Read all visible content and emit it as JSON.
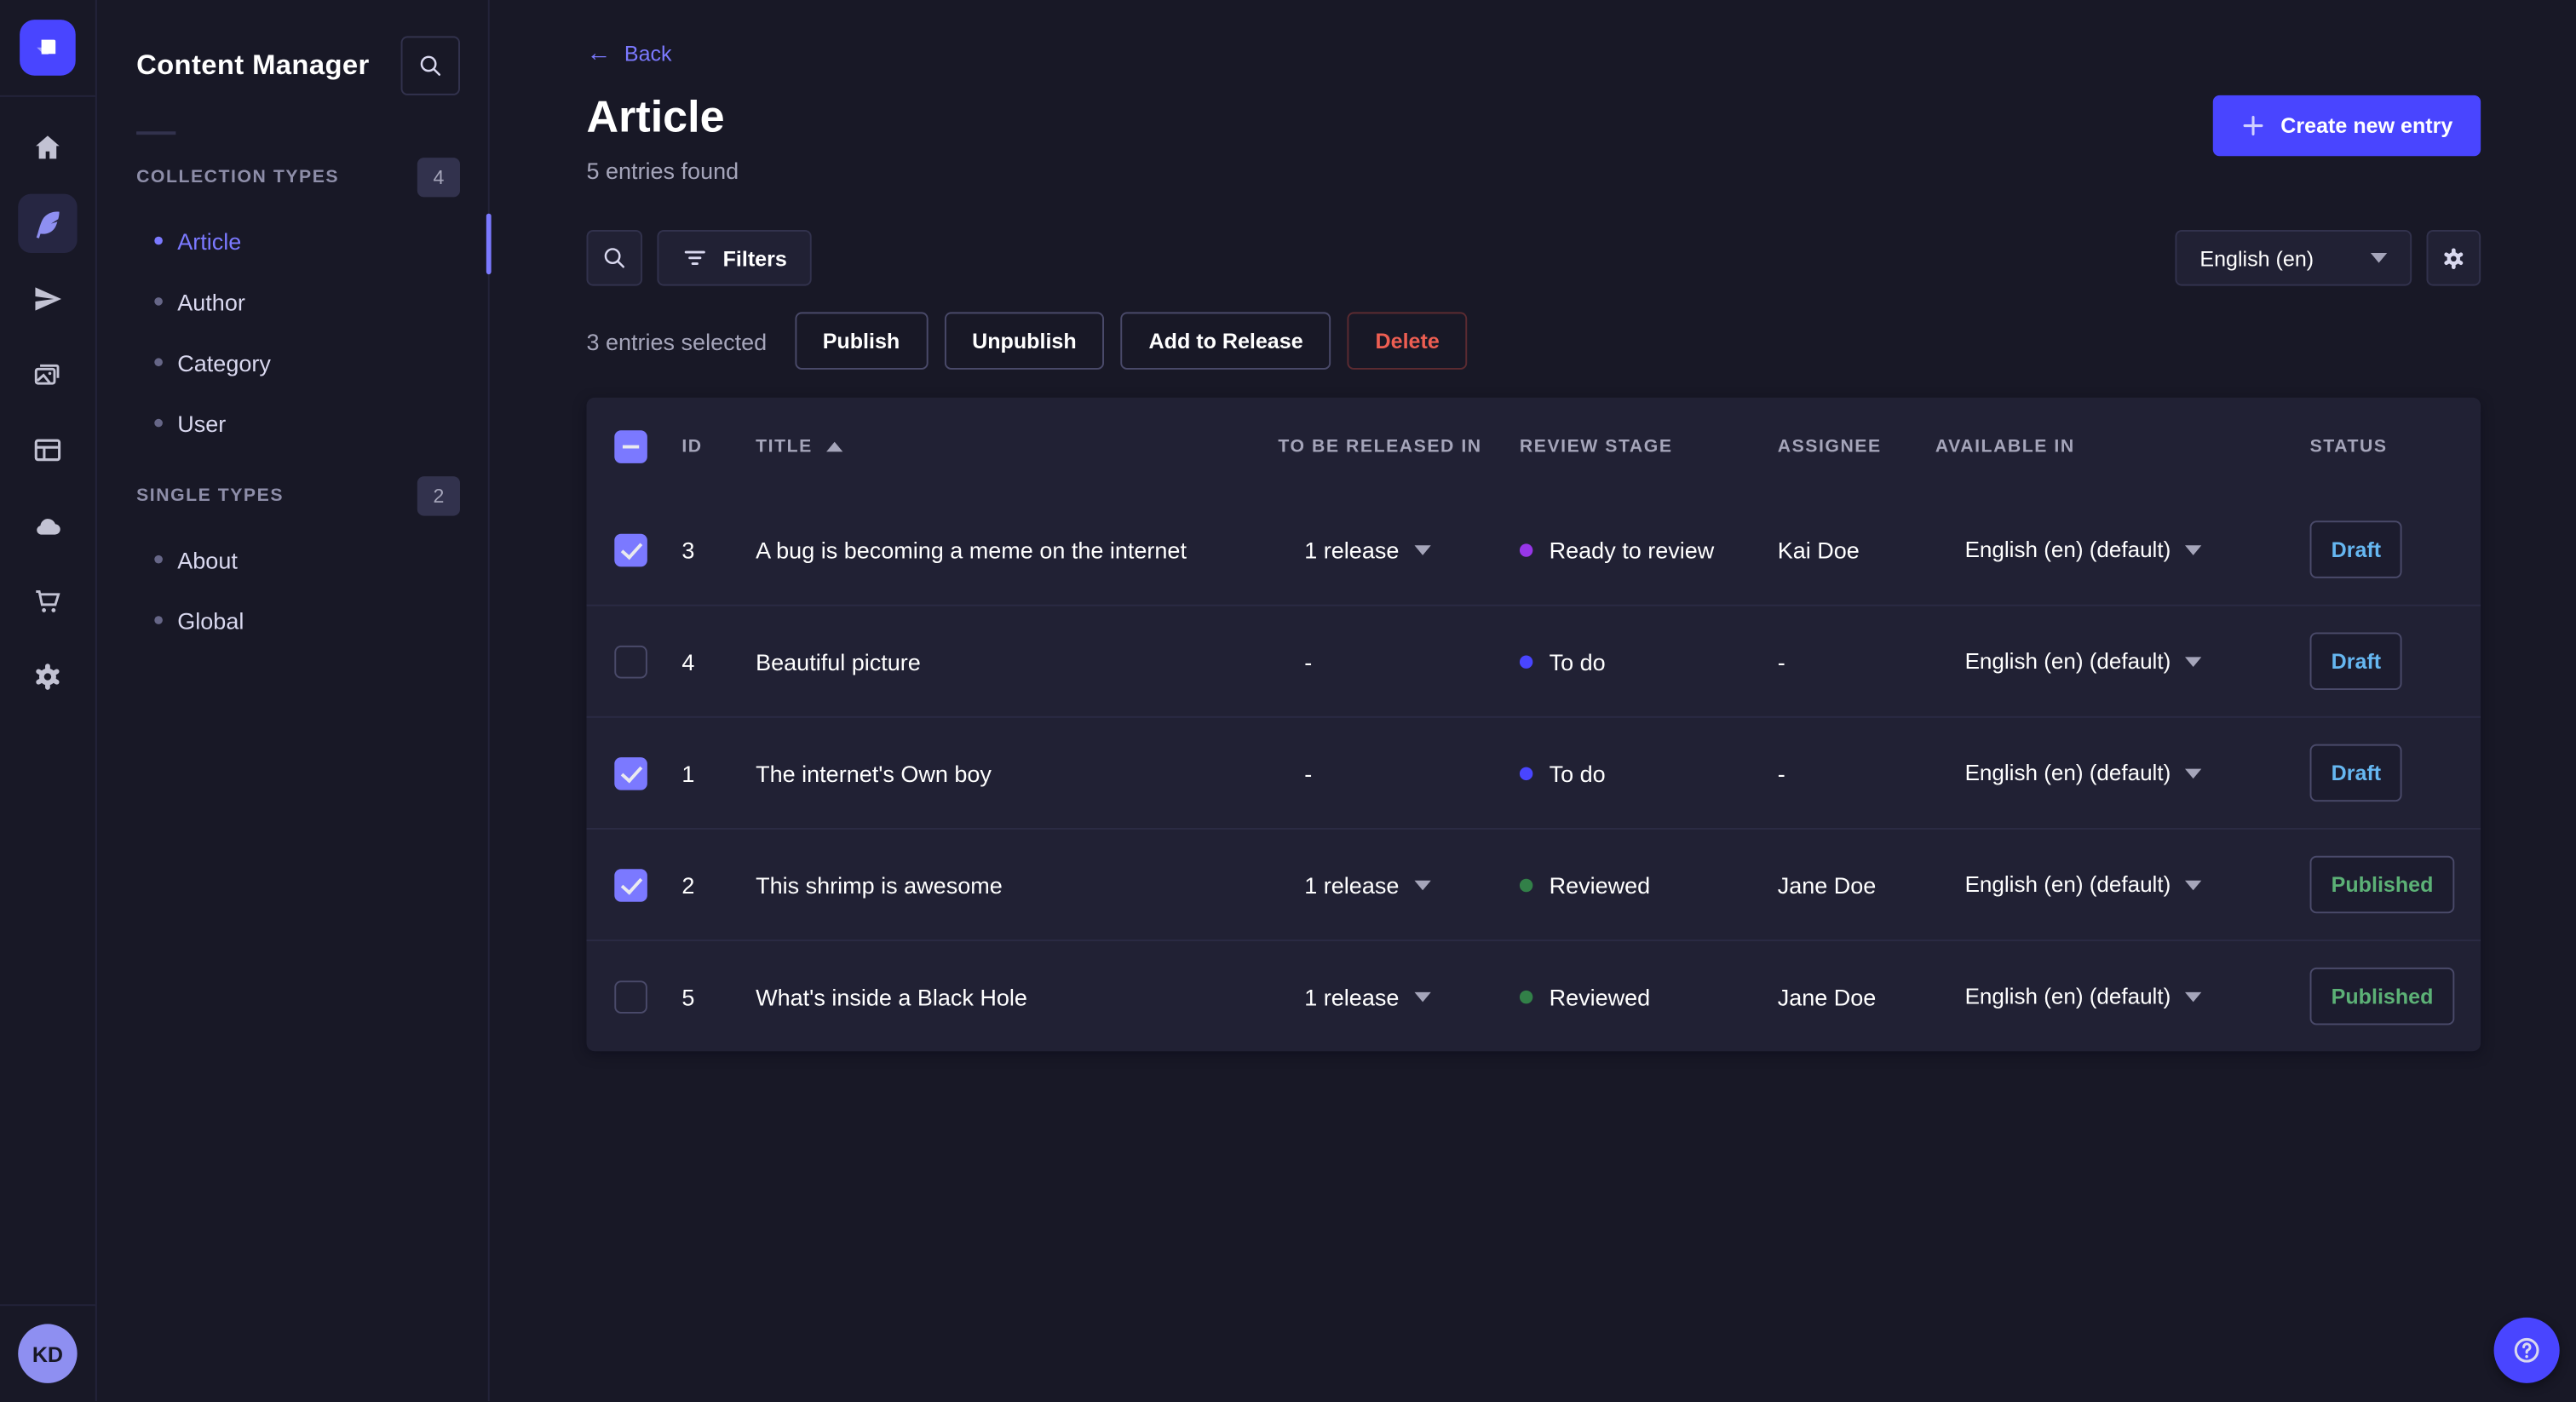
{
  "app": {
    "logo_icon": "strapi-logo",
    "help_icon": "help-icon"
  },
  "nav_rail": {
    "icons": [
      "home-icon",
      "feather-icon",
      "send-icon",
      "media-library-icon",
      "layout-icon",
      "cloud-icon",
      "cart-icon",
      "settings-icon"
    ],
    "active_icon": "feather-icon",
    "avatar_initials": "KD"
  },
  "sidebar": {
    "title": "Content Manager",
    "search_icon": "search-icon",
    "sections": [
      {
        "label": "COLLECTION TYPES",
        "count": "4",
        "items": [
          {
            "label": "Article",
            "active": true
          },
          {
            "label": "Author",
            "active": false
          },
          {
            "label": "Category",
            "active": false
          },
          {
            "label": "User",
            "active": false
          }
        ]
      },
      {
        "label": "SINGLE TYPES",
        "count": "2",
        "items": [
          {
            "label": "About",
            "active": false
          },
          {
            "label": "Global",
            "active": false
          }
        ]
      }
    ]
  },
  "header": {
    "back_label": "Back",
    "back_icon": "arrow-left-icon",
    "title": "Article",
    "subtitle": "5 entries found",
    "create_button": "Create new entry",
    "create_icon": "plus-icon"
  },
  "toolbar": {
    "search_icon": "search-icon",
    "filters_label": "Filters",
    "filters_icon": "filter-icon",
    "locale_selected": "English (en)",
    "settings_icon": "gear-icon"
  },
  "selection": {
    "text": "3 entries selected",
    "actions": [
      "Publish",
      "Unpublish",
      "Add to Release",
      "Delete"
    ]
  },
  "table": {
    "columns": [
      "ID",
      "TITLE",
      "TO BE RELEASED IN",
      "REVIEW STAGE",
      "ASSIGNEE",
      "AVAILABLE IN",
      "STATUS"
    ],
    "sort_column": "TITLE",
    "sort_direction": "asc",
    "header_checkbox_state": "indeterminate",
    "rows": [
      {
        "checked": true,
        "id": "3",
        "title": "A bug is becoming a meme on the internet",
        "release": "1 release",
        "release_caret": true,
        "stage": "Ready to review",
        "stage_color": "#9736e8",
        "assignee": "Kai Doe",
        "locale": "English (en) (default)",
        "status": "Draft"
      },
      {
        "checked": false,
        "id": "4",
        "title": "Beautiful picture",
        "release": "-",
        "release_caret": false,
        "stage": "To do",
        "stage_color": "#4945ff",
        "assignee": "-",
        "locale": "English (en) (default)",
        "status": "Draft"
      },
      {
        "checked": true,
        "id": "1",
        "title": "The internet's Own boy",
        "release": "-",
        "release_caret": false,
        "stage": "To do",
        "stage_color": "#4945ff",
        "assignee": "-",
        "locale": "English (en) (default)",
        "status": "Draft"
      },
      {
        "checked": true,
        "id": "2",
        "title": "This shrimp is awesome",
        "release": "1 release",
        "release_caret": true,
        "stage": "Reviewed",
        "stage_color": "#328048",
        "assignee": "Jane Doe",
        "locale": "English (en) (default)",
        "status": "Published"
      },
      {
        "checked": false,
        "id": "5",
        "title": "What's inside a Black Hole",
        "release": "1 release",
        "release_caret": true,
        "stage": "Reviewed",
        "stage_color": "#328048",
        "assignee": "Jane Doe",
        "locale": "English (en) (default)",
        "status": "Published"
      }
    ]
  },
  "colors": {
    "accent": "#4945ff",
    "accent_light": "#7b79ff",
    "page_bg": "#181826",
    "panel_bg": "#212134",
    "border": "#32324d",
    "text_secondary": "#a5a5ba",
    "status_draft": "#66b7f1",
    "status_published": "#5cb176",
    "danger": "#ee5e52",
    "stage_ready_to_review": "#9736e8",
    "stage_to_do": "#4945ff",
    "stage_reviewed": "#328048"
  }
}
